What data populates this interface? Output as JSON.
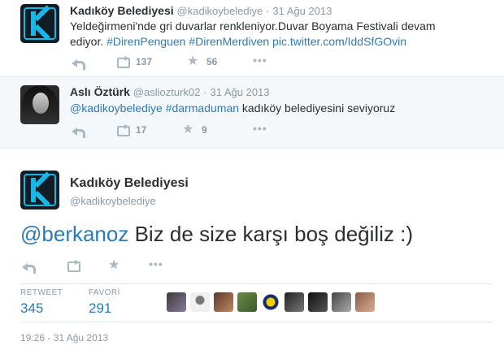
{
  "tweets": [
    {
      "name": "Kadıköy Belediyesi",
      "handle": "@kadikoybelediye",
      "time": "31 Ağu 2013",
      "text_line1": "Yeldeğirmeni'nde gri duvarlar renkleniyor.Duvar Boyama Festivali devam",
      "text_line2_plain": "ediyor.",
      "hashtag1": "#DirenPenguen",
      "hashtag2": "#DirenMerdiven",
      "pic_link": "pic.twitter.com/IddSfGOvin",
      "retweets": "137",
      "favorites": "56"
    },
    {
      "name": "Aslı Öztürk",
      "handle": "@asliozturk02",
      "time": "31 Ağu 2013",
      "mention": "@kadikoybelediye",
      "hashtag": "#darmaduman",
      "text_rest": "kadıköy belediyesini seviyoruz",
      "retweets": "17",
      "favorites": "9"
    }
  ],
  "main": {
    "name": "Kadıköy Belediyesi",
    "handle": "@kadikoybelediye",
    "mention": "@berkanoz",
    "text": "Biz de size karşı boş değiliz :)",
    "retweet_label": "RETWEET",
    "retweet_count": "345",
    "favorite_label": "FAVORİ",
    "favorite_count": "291",
    "timestamp": "19:26 - 31 Ağu 2013"
  },
  "colors": {
    "link": "#2b7bb9",
    "muted": "#8899a6",
    "brand_logo_bg": "#121c24",
    "brand_logo_accent": "#18b8e6"
  },
  "icons": [
    "reply-icon",
    "retweet-icon",
    "favorite-star-icon",
    "more-dots-icon"
  ],
  "dot_separator": "·"
}
